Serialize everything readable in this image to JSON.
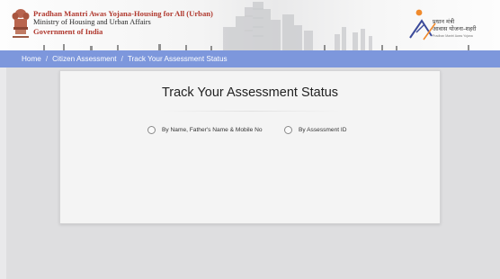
{
  "header": {
    "ministry_line1": "Pradhan Mantri Awas Yojana-Housing for All (Urban)",
    "ministry_line2": "Ministry of Housing and Urban Affairs",
    "ministry_line3": "Government of India",
    "pmay_hindi_line1": "प्रधान मंत्री",
    "pmay_hindi_line2": "आवास योजना-शहरी",
    "pmay_tagline": "Pradhan Mantri Awas Yojana",
    "colors": {
      "ministry_red": "#b0392f",
      "nav_bg": "#7d97dc"
    }
  },
  "breadcrumb": {
    "items": [
      "Home",
      "Citizen Assessment",
      "Track Your Assessment Status"
    ],
    "separator": "/"
  },
  "main": {
    "title": "Track Your Assessment Status",
    "options": [
      {
        "label": "By Name, Father's Name & Mobile No",
        "selected": false
      },
      {
        "label": "By Assessment ID",
        "selected": false
      }
    ]
  }
}
